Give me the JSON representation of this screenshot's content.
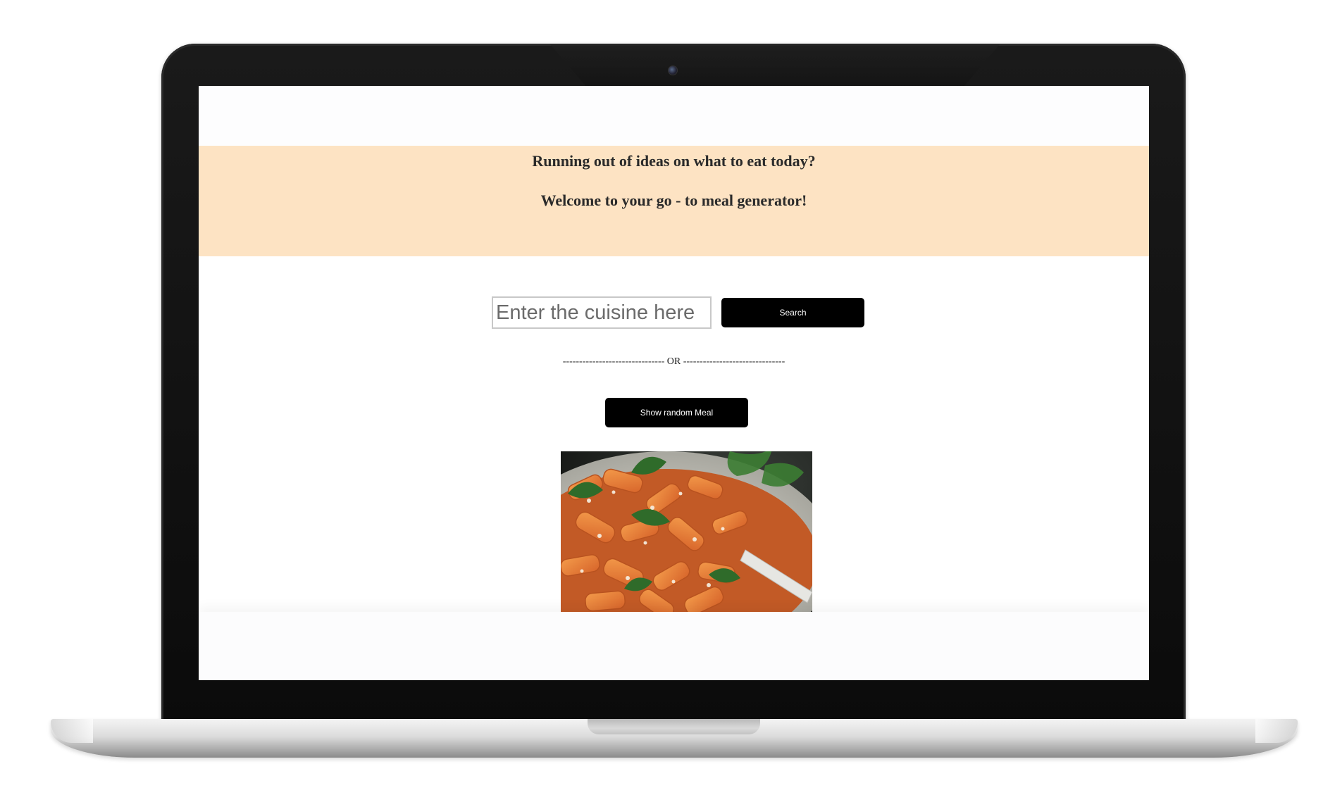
{
  "hero": {
    "line1": "Running out of ideas on what to eat today?",
    "line2": "Welcome to your go - to meal generator!"
  },
  "search": {
    "placeholder": "Enter the cuisine here",
    "value": "",
    "button_label": "Search"
  },
  "divider": {
    "text": "------------------------------- OR -------------------------------"
  },
  "random": {
    "button_label": "Show random Meal"
  },
  "meal_image": {
    "icon": "pasta-dish-image"
  },
  "colors": {
    "hero_background": "#fde3c3",
    "button_background": "#000000",
    "button_text": "#ffffff"
  }
}
